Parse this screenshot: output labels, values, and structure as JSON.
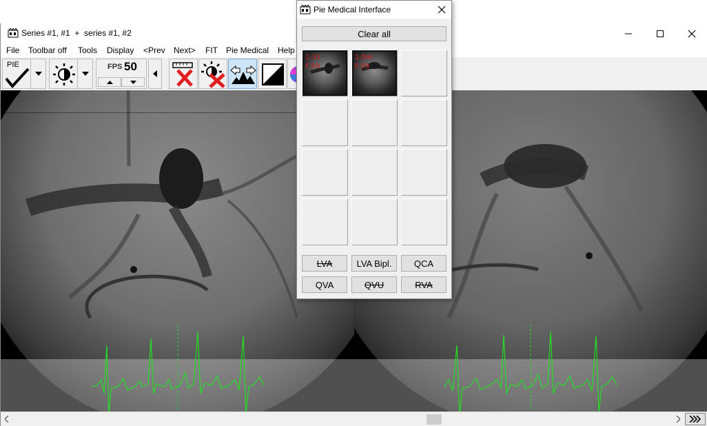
{
  "main_window": {
    "title": "Series #1, #1  +  series #1, #2"
  },
  "menu": {
    "items": [
      {
        "label": "File"
      },
      {
        "label": "Toolbar off"
      },
      {
        "label": "Tools"
      },
      {
        "label": "Display"
      },
      {
        "label": "<Prev"
      },
      {
        "label": "Next>"
      },
      {
        "label": "FIT"
      },
      {
        "label": "Pie Medical"
      },
      {
        "label": "Help"
      }
    ]
  },
  "toolbar": {
    "pie_label": "PIE",
    "fps_label": "FPS",
    "fps_value": "50",
    "icons": [
      "pie-check-icon",
      "brightness-icon",
      "measure-cancel-icon",
      "brightness-cancel-icon",
      "swap-arrows-icon",
      "contrast-icon",
      "color-wheel-icon"
    ]
  },
  "pie_dialog": {
    "title": "Pie Medical Interface",
    "clear_all_label": "Clear all",
    "thumbnails": [
      {
        "line1": "1:31",
        "line2": "F:59"
      },
      {
        "line1": "1:59r",
        "line2": "F:59"
      }
    ],
    "buttons": [
      {
        "label": "LVA",
        "enabled": false
      },
      {
        "label": "LVA Bipl.",
        "enabled": true
      },
      {
        "label": "QCA",
        "enabled": true
      },
      {
        "label": "QVA",
        "enabled": true
      },
      {
        "label": "QVU",
        "enabled": false
      },
      {
        "label": "RVA",
        "enabled": false
      }
    ]
  },
  "colors": {
    "ecg_trace": "#22e022",
    "thumb_text": "#d81c1c",
    "cancel_x": "#e02020"
  }
}
